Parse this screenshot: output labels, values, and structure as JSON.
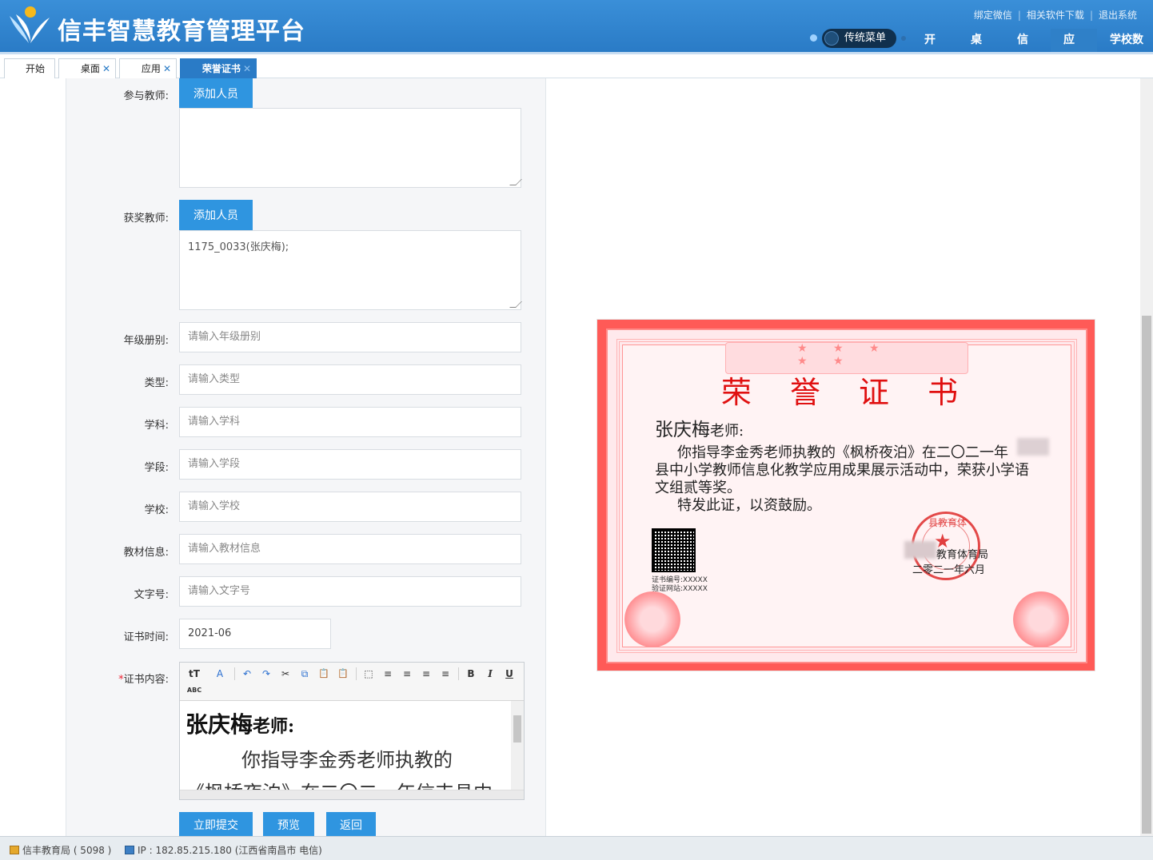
{
  "header": {
    "title": "信丰智慧教育管理平台",
    "links": [
      "绑定微信",
      "相关软件下载",
      "退出系统"
    ],
    "mode_toggle": "传统菜单",
    "nav": [
      {
        "label": "开始",
        "active": false
      },
      {
        "label": "桌面",
        "active": false
      },
      {
        "label": "信息",
        "active": false
      },
      {
        "label": "应用",
        "active": true
      },
      {
        "label": "学校数据",
        "active": false
      }
    ],
    "accent_color": "#2a7bc6"
  },
  "tabs": [
    {
      "label": "开始",
      "closable": false,
      "active": false
    },
    {
      "label": "桌面",
      "closable": true,
      "active": false
    },
    {
      "label": "应用",
      "closable": true,
      "active": false
    },
    {
      "label": "荣誉证书",
      "closable": true,
      "active": true
    }
  ],
  "form": {
    "participants": {
      "label": "参与教师:",
      "button": "添加人员",
      "value": ""
    },
    "winners": {
      "label": "获奖教师:",
      "button": "添加人员",
      "value": "1175_0033(张庆梅);"
    },
    "fields": [
      {
        "label": "年级册别:",
        "placeholder": "请输入年级册别",
        "value": ""
      },
      {
        "label": "类型:",
        "placeholder": "请输入类型",
        "value": ""
      },
      {
        "label": "学科:",
        "placeholder": "请输入学科",
        "value": ""
      },
      {
        "label": "学段:",
        "placeholder": "请输入学段",
        "value": ""
      },
      {
        "label": "学校:",
        "placeholder": "请输入学校",
        "value": ""
      },
      {
        "label": "教材信息:",
        "placeholder": "请输入教材信息",
        "value": ""
      },
      {
        "label": "文字号:",
        "placeholder": "请输入文字号",
        "value": ""
      }
    ],
    "cert_time": {
      "label": "证书时间:",
      "value": "2021-06"
    },
    "content": {
      "required_mark": "*",
      "label": "证书内容:",
      "toolbar": [
        "tT",
        "A",
        "↶",
        "↷",
        "✂",
        "⧉",
        "📋",
        "📋",
        "⬚",
        "≡",
        "≡",
        "≡",
        "≡",
        "B",
        "I",
        "U",
        "ABC"
      ],
      "name": "张庆梅",
      "suffix": "老师:",
      "line1": "你指导李金秀老师执教的",
      "line2": "《枫桥夜泊》在二〇二一年信丰县中"
    },
    "buttons": {
      "submit": "立即提交",
      "preview": "预览",
      "back": "返回"
    }
  },
  "certificate": {
    "title": "荣 誉 证 书",
    "stars": "★ ★ ★ ★ ★",
    "name": "张庆梅",
    "suffix": "老师:",
    "line1": "你指导李金秀老师执教的《枫桥夜泊》在二〇二一年",
    "line2": "县中小学教师信息化教学应用成果展示活动中，荣获小学语",
    "line3": "文组贰等奖。",
    "line4": "特发此证，以资鼓励。",
    "cert_no": "证书编号:XXXXX",
    "verify_url": "验证网站:XXXXX",
    "seal_text": "县教育体",
    "issuer": "教育体育局",
    "date": "二零二一年六月"
  },
  "statusbar": {
    "org": "信丰教育局 ( 5098 )",
    "ip": "IP : 182.85.215.180 (江西省南昌市 电信)"
  }
}
